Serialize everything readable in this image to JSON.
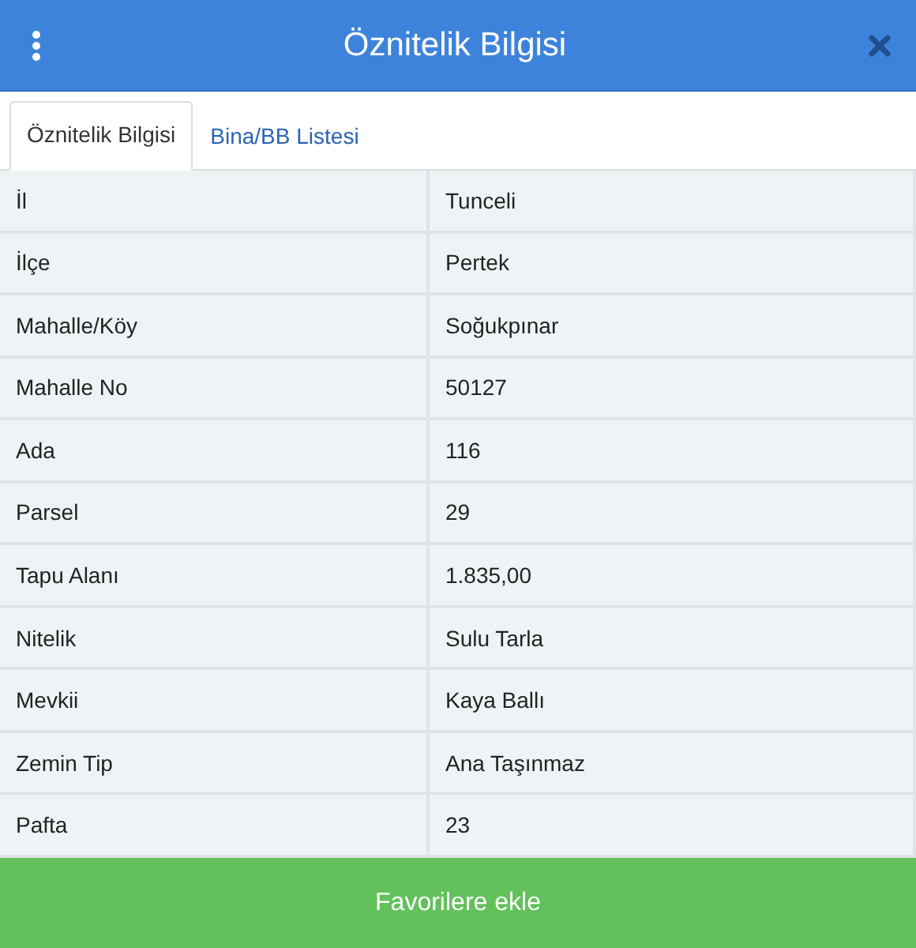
{
  "header": {
    "title": "Öznitelik Bilgisi"
  },
  "tabs": [
    {
      "label": "Öznitelik Bilgisi",
      "selected": true
    },
    {
      "label": "Bina/BB Listesi",
      "selected": false
    }
  ],
  "rows": [
    {
      "label": "İl",
      "value": "Tunceli"
    },
    {
      "label": "İlçe",
      "value": "Pertek"
    },
    {
      "label": "Mahalle/Köy",
      "value": "Soğukpınar"
    },
    {
      "label": "Mahalle No",
      "value": "50127"
    },
    {
      "label": "Ada",
      "value": "116"
    },
    {
      "label": "Parsel",
      "value": "29"
    },
    {
      "label": "Tapu Alanı",
      "value": "1.835,00"
    },
    {
      "label": "Nitelik",
      "value": "Sulu Tarla"
    },
    {
      "label": "Mevkii",
      "value": "Kaya Ballı"
    },
    {
      "label": "Zemin Tip",
      "value": "Ana Taşınmaz"
    },
    {
      "label": "Pafta",
      "value": "23"
    }
  ],
  "footer_button": {
    "label": "Favorilere ekle"
  }
}
